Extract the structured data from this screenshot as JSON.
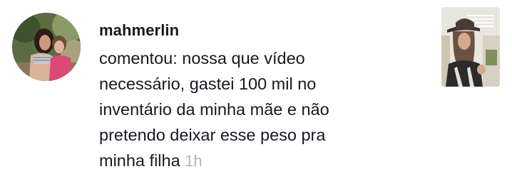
{
  "notification": {
    "username": "mahmerlin",
    "comment_lines": [
      "comentou: nossa que vídeo",
      "necessário, gastei 100 mil no",
      "inventário da minha mãe e não",
      "pretendo deixar esse peso pra",
      "minha filha"
    ],
    "time": "1h",
    "avatar_icon": "profile-photo",
    "thumbnail_icon": "video-thumbnail"
  },
  "colors": {
    "text_primary": "#161823",
    "text_muted": "#b5b5b8",
    "background": "#ffffff"
  }
}
